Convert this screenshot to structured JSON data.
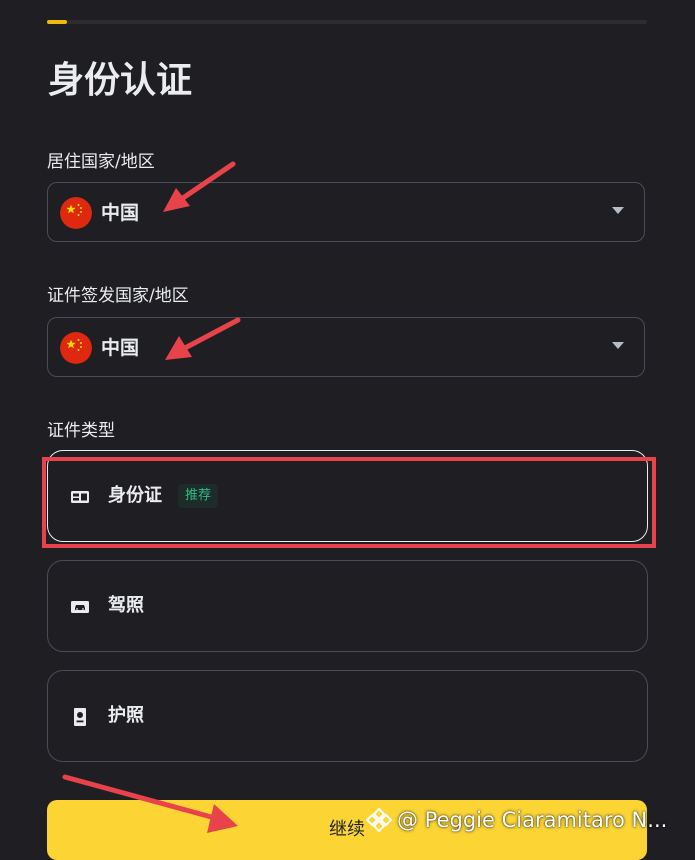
{
  "progress": {
    "value_percent": 3.3,
    "color": "#f0b90b"
  },
  "title": "身份认证",
  "residence": {
    "label": "居住国家/地区",
    "value": "中国",
    "flag_icon": "china-flag-icon"
  },
  "issuing": {
    "label": "证件签发国家/地区",
    "value": "中国",
    "flag_icon": "china-flag-icon"
  },
  "doc_type": {
    "label": "证件类型",
    "options": [
      {
        "label": "身份证",
        "badge": "推荐",
        "icon": "id-card-icon",
        "selected": true
      },
      {
        "label": "驾照",
        "icon": "driver-license-icon"
      },
      {
        "label": "护照",
        "icon": "passport-icon"
      }
    ]
  },
  "continue_label": "继续",
  "watermark": "@ Peggie Ciaramitaro N...",
  "colors": {
    "background": "#1f1f23",
    "accent": "#fcd535",
    "annotation": "#e8424a",
    "badge_text": "#2ebd85"
  }
}
